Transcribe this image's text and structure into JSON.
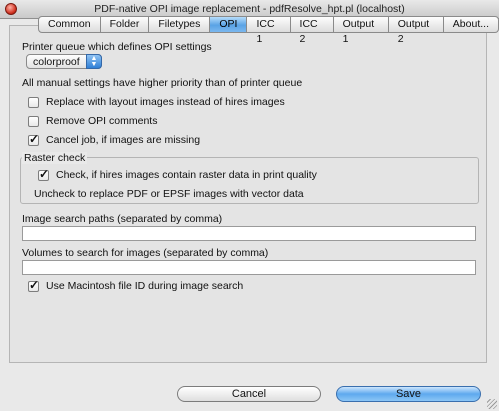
{
  "window": {
    "title": "PDF-native OPI image replacement - pdfResolve_hpt.pl (localhost)"
  },
  "tabs": [
    "Common",
    "Folder",
    "Filetypes",
    "OPI",
    "ICC 1",
    "ICC 2",
    "Output 1",
    "Output 2",
    "About..."
  ],
  "active_tab": "OPI",
  "opi": {
    "printer_queue_label": "Printer queue which defines OPI settings",
    "printer_queue_value": "colorproof",
    "priority_note": "All manual settings have higher priority than of printer queue",
    "replace_layout": {
      "label": "Replace with layout images instead of hires images",
      "checked": false
    },
    "remove_comments": {
      "label": "Remove OPI comments",
      "checked": false
    },
    "cancel_job": {
      "label": "Cancel job, if images are missing",
      "checked": true
    },
    "raster_check": {
      "title": "Raster check",
      "check_hires": {
        "label": "Check, if hires images contain raster data in print quality",
        "checked": true
      },
      "note": "Uncheck to replace PDF or EPSF images with vector data"
    },
    "image_search_label": "Image search paths (separated by comma)",
    "image_search_value": "",
    "volumes_label": "Volumes to search for images (separated by comma)",
    "volumes_value": "",
    "mac_file_id": {
      "label": "Use Macintosh file ID during image search",
      "checked": true
    }
  },
  "buttons": {
    "cancel": "Cancel",
    "save": "Save"
  },
  "colors": {
    "accent": "#5aa3e5",
    "window_bg": "#e9e9e9"
  }
}
